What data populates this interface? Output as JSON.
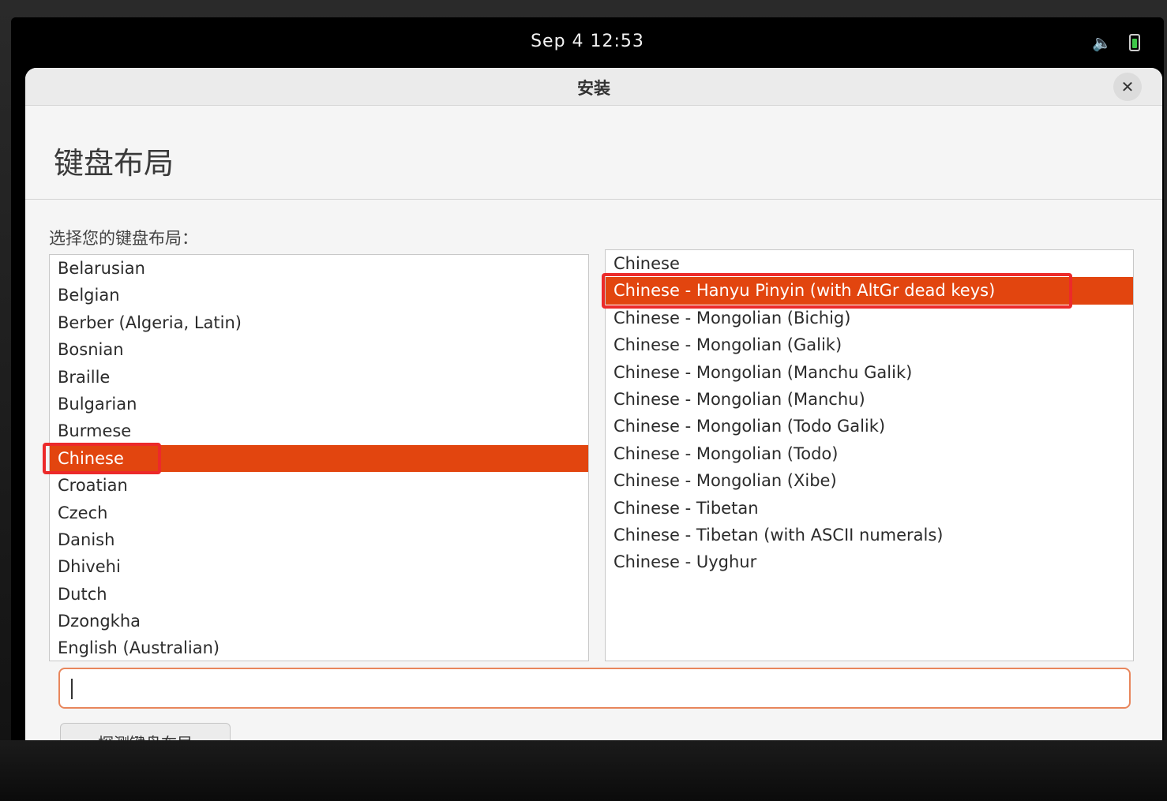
{
  "topbar": {
    "clock": "Sep 4  12:53",
    "volume_icon": "speaker-icon",
    "battery_icon": "battery-charging-icon"
  },
  "window": {
    "title": "安装",
    "close_label": "✕"
  },
  "page": {
    "heading": "键盘布局",
    "prompt": "选择您的键盘布局："
  },
  "layouts": [
    "Belarusian",
    "Belgian",
    "Berber (Algeria, Latin)",
    "Bosnian",
    "Braille",
    "Bulgarian",
    "Burmese",
    "Chinese",
    "Croatian",
    "Czech",
    "Danish",
    "Dhivehi",
    "Dutch",
    "Dzongkha",
    "English (Australian)"
  ],
  "variants": [
    "Chinese",
    "Chinese - Hanyu Pinyin (with AltGr dead keys)",
    "Chinese - Mongolian (Bichig)",
    "Chinese - Mongolian (Galik)",
    "Chinese - Mongolian (Manchu Galik)",
    "Chinese - Mongolian (Manchu)",
    "Chinese - Mongolian (Todo Galik)",
    "Chinese - Mongolian (Todo)",
    "Chinese - Mongolian (Xibe)",
    "Chinese - Tibetan",
    "Chinese - Tibetan (with ASCII numerals)",
    "Chinese - Uyghur"
  ],
  "selected_layout": "Chinese",
  "selected_variant": "Chinese - Hanyu Pinyin (with AltGr dead keys)",
  "test_input": {
    "value": ""
  },
  "detect_button": "探测键盘布局",
  "colors": {
    "selection": "#e2450f",
    "annotation": "#ec2a2a"
  }
}
